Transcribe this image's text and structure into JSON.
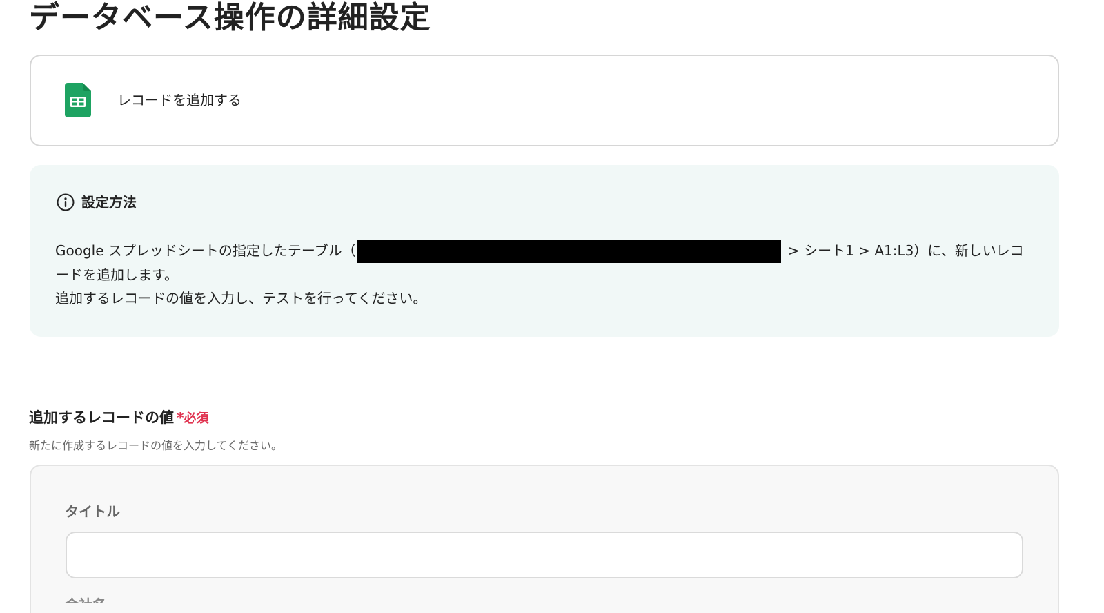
{
  "page": {
    "title": "データベース操作の詳細設定"
  },
  "action": {
    "icon": "google-sheets-icon",
    "label": "レコードを追加する"
  },
  "info": {
    "icon": "info-icon",
    "heading": "設定方法",
    "line1_prefix": "Google スプレッドシートの指定したテーブル（",
    "line1_suffix": " > シート1 > A1:L3）に、新しいレコ",
    "line2": "ードを追加します。",
    "line3": "追加するレコードの値を入力し、テストを行ってください。"
  },
  "field": {
    "label": "追加するレコードの値",
    "required_mark": "*",
    "required_text": "必須",
    "description": "新たに作成するレコードの値を入力してください。"
  },
  "record": {
    "title_label": "タイトル",
    "title_value": "",
    "title_placeholder": "",
    "next_label": "会社名"
  },
  "colors": {
    "required": "#e0324f",
    "info_bg": "#f1f8f7",
    "sheets_green": "#1ea362"
  }
}
